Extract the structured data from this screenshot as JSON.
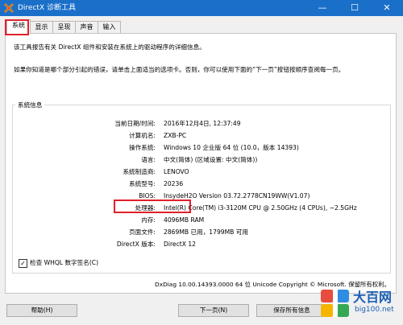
{
  "window": {
    "title": "DirectX 诊断工具",
    "minimize": "—",
    "maximize": "☐",
    "close": "✕"
  },
  "tabs": [
    {
      "label": "系统",
      "active": true
    },
    {
      "label": "显示"
    },
    {
      "label": "呈现"
    },
    {
      "label": "声音"
    },
    {
      "label": "输入"
    }
  ],
  "intro": {
    "line1": "该工具报告有关 DirectX 组件和安装在系统上的驱动程序的详细信息。",
    "line2": "如果你知道是哪个部分引起的错误，请单击上面适当的选项卡。否则，你可以使用下面的“下一页”按钮按顺序查阅每一页。"
  },
  "system_info": {
    "group_title": "系统信息",
    "rows": [
      {
        "label": "当前日期/时间:",
        "value": "2016年12月4日, 12:37:49"
      },
      {
        "label": "计算机名:",
        "value": "ZXB-PC"
      },
      {
        "label": "操作系统:",
        "value": "Windows 10 企业版 64 位 (10.0，版本 14393)"
      },
      {
        "label": "语言:",
        "value": "中文(简体) (区域设置: 中文(简体))"
      },
      {
        "label": "系统制造商:",
        "value": "LENOVO"
      },
      {
        "label": "系统型号:",
        "value": "20236"
      },
      {
        "label": "BIOS:",
        "value": "InsydeH2O Version 03.72.2778CN19WW(V1.07)"
      },
      {
        "label": "处理器:",
        "value": "Intel(R) Core(TM) i3-3120M CPU @ 2.50GHz (4 CPUs), ~2.5GHz"
      },
      {
        "label": "内存:",
        "value": "4096MB RAM"
      },
      {
        "label": "页面文件:",
        "value": "2869MB 已用，1799MB 可用"
      },
      {
        "label": "DirectX 版本:",
        "value": "DirectX 12"
      }
    ]
  },
  "whql": {
    "label": "检查 WHQL 数字签名(C)",
    "checked": true,
    "check_mark": "✓"
  },
  "footer": "DxDiag 10.00.14393.0000 64 位 Unicode  Copyright © Microsoft. 保留所有权利。",
  "buttons": {
    "help": "帮助(H)",
    "next": "下一页(N)",
    "save": "保存所有信息"
  },
  "watermark": {
    "title": "大百网",
    "url": "big100.net"
  },
  "colors": {
    "titlebar": "#1a6fc9",
    "highlight": "#e0202a"
  }
}
